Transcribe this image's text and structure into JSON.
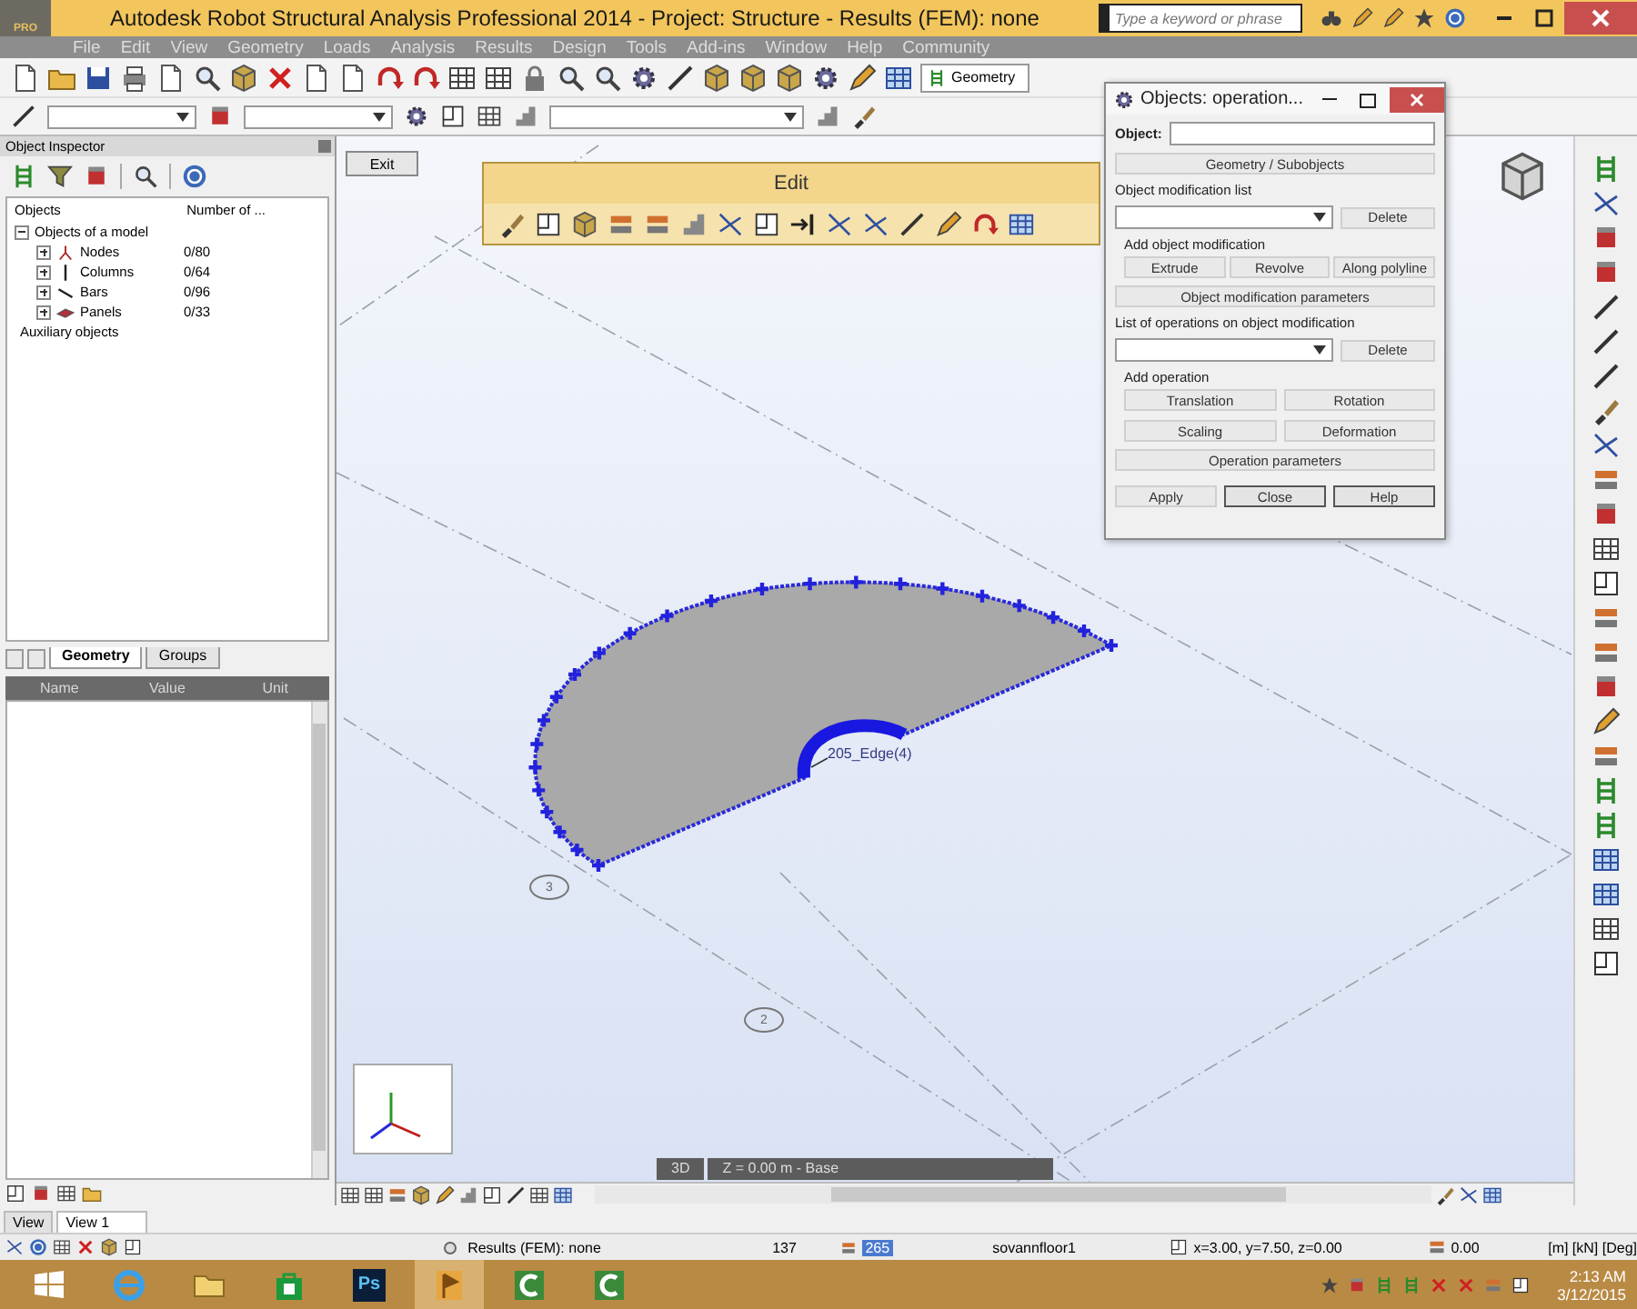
{
  "window": {
    "title": "Autodesk Robot Structural Analysis Professional 2014 - Project: Structure - Results (FEM): none",
    "logo": "PRO"
  },
  "search": {
    "placeholder": "Type a keyword or phrase"
  },
  "menu": [
    "File",
    "Edit",
    "View",
    "Geometry",
    "Loads",
    "Analysis",
    "Results",
    "Design",
    "Tools",
    "Add-ins",
    "Window",
    "Help",
    "Community"
  ],
  "toolbar": {
    "layout": "Geometry"
  },
  "inspector": {
    "title": "Object Inspector",
    "columns": [
      "Objects",
      "Number of ..."
    ],
    "tree": [
      {
        "label": "Objects of a model",
        "expanded": true,
        "children": [
          {
            "kind": "node",
            "label": "Nodes",
            "count": "0/80",
            "expanded": false
          },
          {
            "kind": "column",
            "label": "Columns",
            "count": "0/64",
            "expanded": false
          },
          {
            "kind": "bar",
            "label": "Bars",
            "count": "0/96",
            "expanded": false
          },
          {
            "kind": "panel",
            "label": "Panels",
            "count": "0/33",
            "expanded": false
          }
        ]
      },
      {
        "label": "Auxiliary objects"
      }
    ],
    "tabs": [
      {
        "label": "Geometry",
        "selected": true
      },
      {
        "label": "Groups",
        "selected": false
      }
    ],
    "property_columns": [
      "Name",
      "Value",
      "Unit"
    ]
  },
  "viewport": {
    "exit": "Exit",
    "edge_label": "205_Edge(4)",
    "axis_markers": [
      "3",
      "2"
    ],
    "view_mode": "3D",
    "level": "Z = 0.00 m - Base"
  },
  "edit_toolbar": {
    "title": "Edit"
  },
  "dialog": {
    "title": "Objects: operation...",
    "object_label": "Object:",
    "subobjects_button": "Geometry / Subobjects",
    "modification": {
      "label": "Object modification list",
      "delete": "Delete",
      "add_label": "Add object modification",
      "actions": [
        "Extrude",
        "Revolve",
        "Along polyline"
      ],
      "parameters": "Object modification parameters"
    },
    "operations": {
      "label": "List of operations on object modification",
      "delete": "Delete",
      "add_label": "Add operation",
      "actions": [
        "Translation",
        "Rotation",
        "Scaling",
        "Deformation"
      ],
      "parameters": "Operation parameters"
    },
    "buttons": [
      "Apply",
      "Close",
      "Help"
    ]
  },
  "view_tabs": [
    {
      "label": "View",
      "selected": false
    },
    {
      "label": "View 1",
      "selected": true
    }
  ],
  "status_bar": {
    "results": "Results (FEM): none",
    "node_count": "137",
    "bar_count": "265",
    "section": "sovannfloor1",
    "coordinates": "x=3.00, y=7.50, z=0.00",
    "angle": "0.00",
    "units": "[m] [kN] [Deg]"
  },
  "taskbar": {
    "apps": [
      {
        "kind": "browser",
        "active": false
      },
      {
        "kind": "folder",
        "active": false
      },
      {
        "kind": "store",
        "active": false
      },
      {
        "kind": "photoshop",
        "label": "Ps",
        "active": false
      },
      {
        "kind": "robot",
        "active": true
      },
      {
        "kind": "camtasia",
        "active": false
      },
      {
        "kind": "camtasia",
        "active": false
      }
    ],
    "time": "2:13 AM",
    "date": "3/12/2015"
  }
}
